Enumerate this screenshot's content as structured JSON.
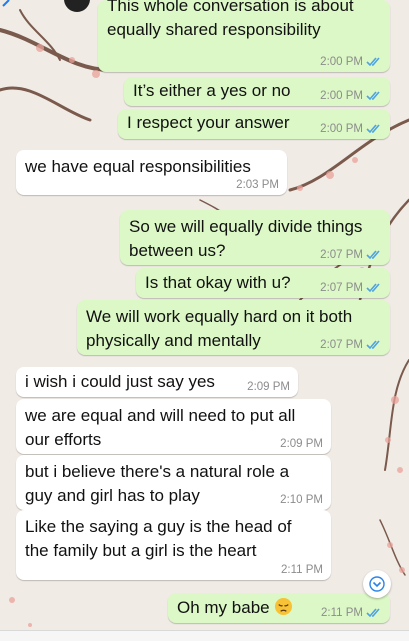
{
  "messages": [
    {
      "text": "This whole conversation is about\nequally shared responsibility",
      "time": "2:00 PM",
      "dir": "out"
    },
    {
      "text": "It’s either a yes or no",
      "time": "2:00 PM",
      "dir": "out"
    },
    {
      "text": "I respect your answer",
      "time": "2:00 PM",
      "dir": "out"
    },
    {
      "text": "we have equal responsibilities",
      "time": "2:03 PM",
      "dir": "in"
    },
    {
      "text": "So we will equally divide things\nbetween us?",
      "time": "2:07 PM",
      "dir": "out"
    },
    {
      "text": "Is that okay with u?",
      "time": "2:07 PM",
      "dir": "out"
    },
    {
      "text": "We will work equally hard on it both\nphysically and mentally",
      "time": "2:07 PM",
      "dir": "out"
    },
    {
      "text": "i wish i could just say yes",
      "time": "2:09 PM",
      "dir": "in"
    },
    {
      "text": "we are equal and will need to put all\nour efforts",
      "time": "2:09 PM",
      "dir": "in"
    },
    {
      "text": "but i believe there's a natural role a\nguy and girl has to play",
      "time": "2:10 PM",
      "dir": "in"
    },
    {
      "text": "Like the saying a guy is the head of\nthe family but a girl is the heart",
      "time": "2:11 PM",
      "dir": "in"
    },
    {
      "text": "Oh my babe",
      "time": "2:11 PM",
      "dir": "out",
      "emoji": "pensive-face"
    }
  ],
  "colors": {
    "outgoing_bubble": "#dcf8c6",
    "incoming_bubble": "#ffffff",
    "read_ticks": "#4fa3e0",
    "wallpaper": "#f1ebe6"
  },
  "icons": {
    "status": "double-check-icon",
    "scroll": "chevron-down-icon"
  }
}
